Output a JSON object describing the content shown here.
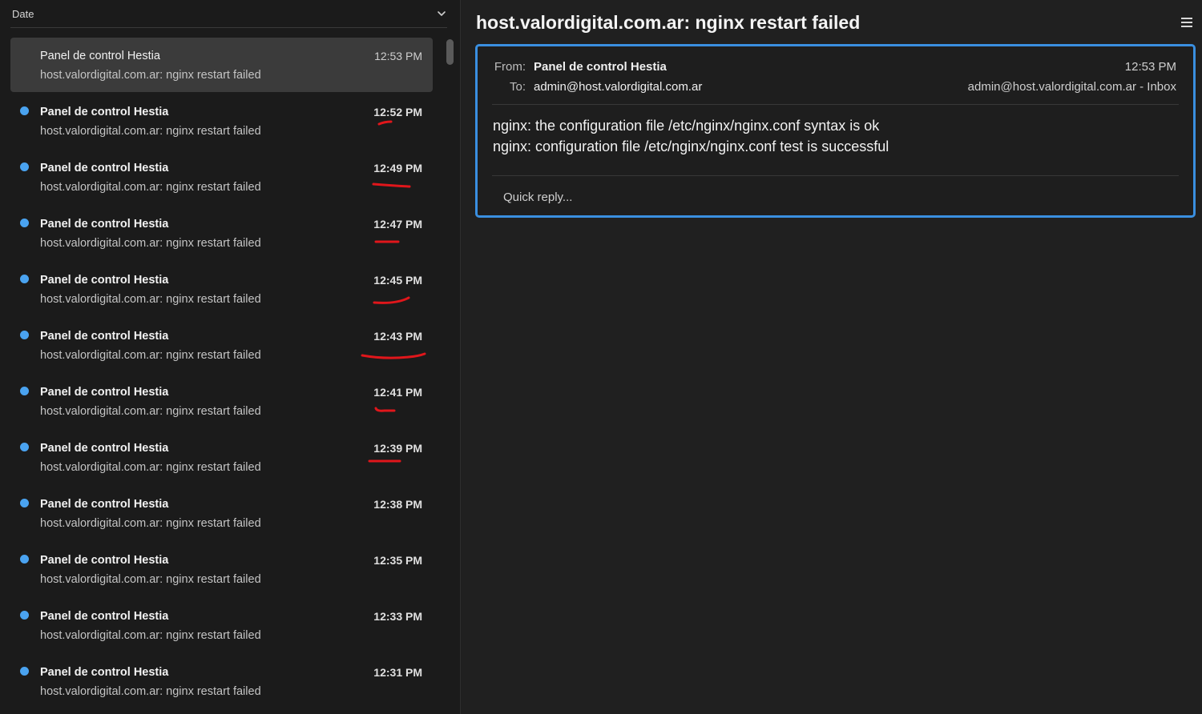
{
  "list": {
    "sort_label": "Date",
    "messages": [
      {
        "sender": "Panel de control Hestia",
        "subject": "host.valordigital.com.ar: nginx restart failed",
        "time": "12:53 PM",
        "unread": false,
        "selected": true
      },
      {
        "sender": "Panel de control Hestia",
        "subject": "host.valordigital.com.ar: nginx restart failed",
        "time": "12:52 PM",
        "unread": true,
        "selected": false
      },
      {
        "sender": "Panel de control Hestia",
        "subject": "host.valordigital.com.ar: nginx restart failed",
        "time": "12:49 PM",
        "unread": true,
        "selected": false
      },
      {
        "sender": "Panel de control Hestia",
        "subject": "host.valordigital.com.ar: nginx restart failed",
        "time": "12:47 PM",
        "unread": true,
        "selected": false
      },
      {
        "sender": "Panel de control Hestia",
        "subject": "host.valordigital.com.ar: nginx restart failed",
        "time": "12:45 PM",
        "unread": true,
        "selected": false
      },
      {
        "sender": "Panel de control Hestia",
        "subject": "host.valordigital.com.ar: nginx restart failed",
        "time": "12:43 PM",
        "unread": true,
        "selected": false
      },
      {
        "sender": "Panel de control Hestia",
        "subject": "host.valordigital.com.ar: nginx restart failed",
        "time": "12:41 PM",
        "unread": true,
        "selected": false
      },
      {
        "sender": "Panel de control Hestia",
        "subject": "host.valordigital.com.ar: nginx restart failed",
        "time": "12:39 PM",
        "unread": true,
        "selected": false
      },
      {
        "sender": "Panel de control Hestia",
        "subject": "host.valordigital.com.ar: nginx restart failed",
        "time": "12:38 PM",
        "unread": true,
        "selected": false
      },
      {
        "sender": "Panel de control Hestia",
        "subject": "host.valordigital.com.ar: nginx restart failed",
        "time": "12:35 PM",
        "unread": true,
        "selected": false
      },
      {
        "sender": "Panel de control Hestia",
        "subject": "host.valordigital.com.ar: nginx restart failed",
        "time": "12:33 PM",
        "unread": true,
        "selected": false
      },
      {
        "sender": "Panel de control Hestia",
        "subject": "host.valordigital.com.ar: nginx restart failed",
        "time": "12:31 PM",
        "unread": true,
        "selected": false
      }
    ]
  },
  "reading": {
    "title": "host.valordigital.com.ar: nginx restart failed",
    "from_label": "From:",
    "from": "Panel de control Hestia",
    "to_label": "To:",
    "to": "admin@host.valordigital.com.ar",
    "time": "12:53 PM",
    "account_folder": "admin@host.valordigital.com.ar - Inbox",
    "body_lines": [
      "nginx: the configuration file /etc/nginx/nginx.conf syntax is ok",
      "nginx: configuration file /etc/nginx/nginx.conf test is successful"
    ],
    "quick_reply_placeholder": "Quick reply..."
  },
  "icons": {
    "sort": "chevron-down-icon",
    "menu": "hamburger-menu-icon",
    "unread": "unread-dot-icon"
  },
  "colors": {
    "accent": "#3a8fe0",
    "unread_dot": "#4aa3f0",
    "annotation": "#e0161b"
  }
}
